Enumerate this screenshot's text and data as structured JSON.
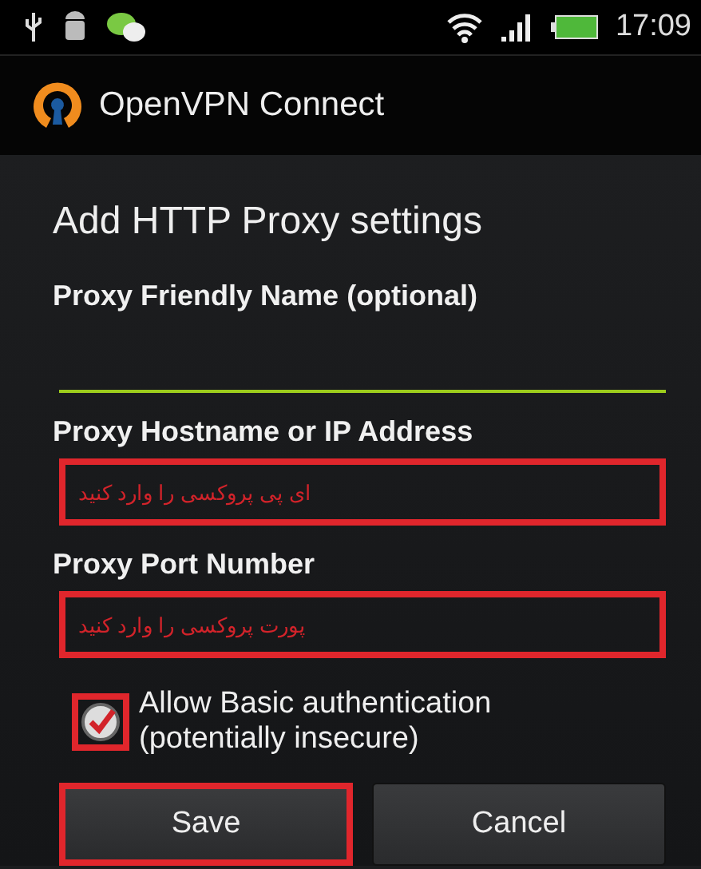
{
  "status_bar": {
    "time": "17:09"
  },
  "app_bar": {
    "title": "OpenVPN Connect"
  },
  "heading": "Add HTTP Proxy settings",
  "fields": [
    {
      "label": "Proxy Friendly Name (optional)",
      "focused": true,
      "highlighted": false
    },
    {
      "label": "Proxy Hostname or IP Address",
      "note": "ای پی پروکسی را وارد کنید",
      "focused": false,
      "highlighted": true
    },
    {
      "label": "Proxy Port Number",
      "note": "پورت پروکسی را وارد کنید",
      "focused": false,
      "highlighted": true
    }
  ],
  "checkbox": {
    "label": "Allow Basic authentication (potentially insecure)",
    "checked": true,
    "highlighted": true
  },
  "buttons": [
    {
      "label": "Save",
      "highlighted": true
    },
    {
      "label": "Cancel",
      "highlighted": false
    }
  ]
}
